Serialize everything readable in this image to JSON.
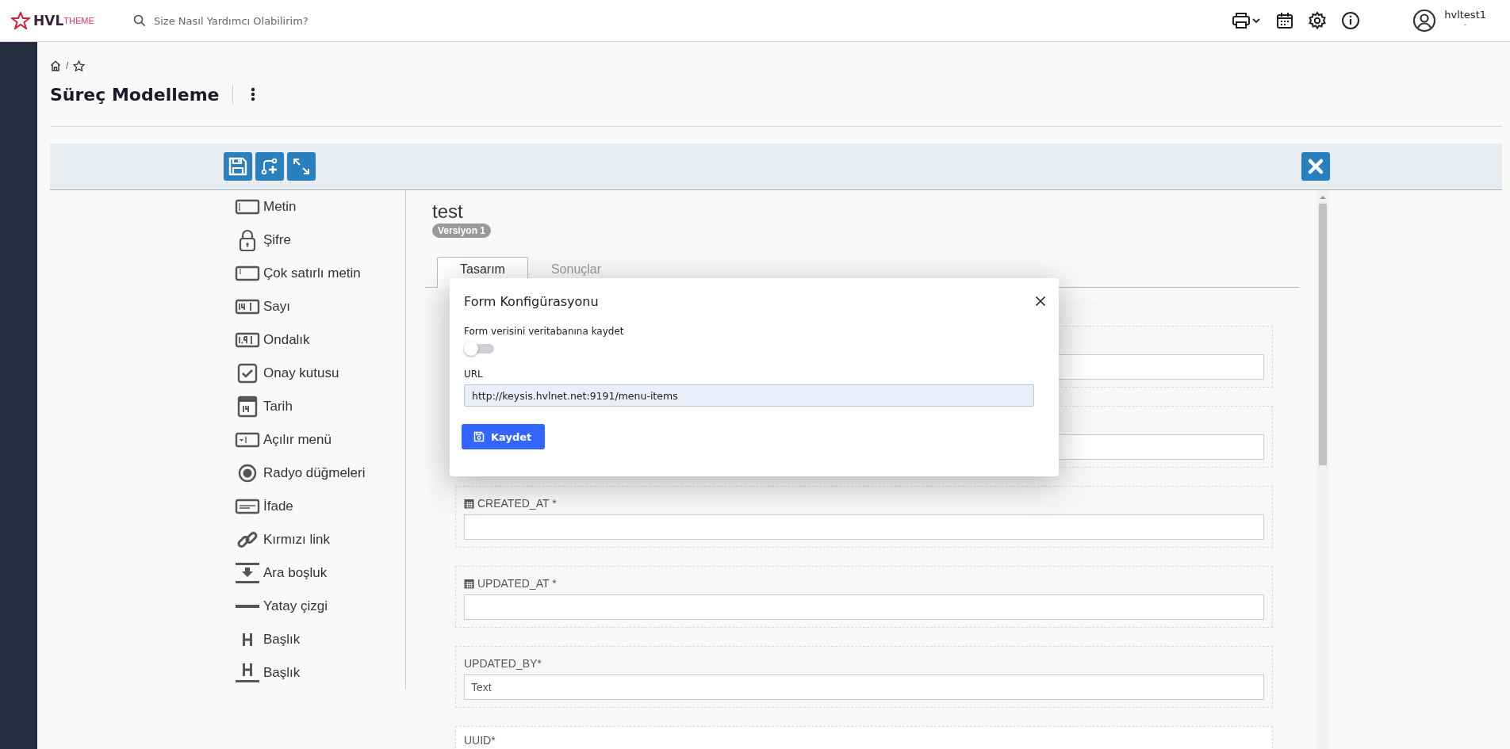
{
  "header": {
    "logo": {
      "brand": "HVL",
      "suffix": "THEME"
    },
    "search": {
      "placeholder": "Size Nasıl Yardımcı Olabilirim?"
    },
    "user": {
      "name": "hvltest1",
      "subtitle": "-"
    }
  },
  "page": {
    "title": "Süreç Modelleme",
    "breadcrumb_separator": "/"
  },
  "palette": [
    {
      "kind": "text",
      "label": "Metin"
    },
    {
      "kind": "password",
      "label": "Şifre"
    },
    {
      "kind": "textarea",
      "label": "Çok satırlı metin"
    },
    {
      "kind": "number",
      "label": "Sayı"
    },
    {
      "kind": "decimal",
      "label": "Ondalık"
    },
    {
      "kind": "checkbox",
      "label": "Onay kutusu"
    },
    {
      "kind": "date",
      "label": "Tarih"
    },
    {
      "kind": "select",
      "label": "Açılır menü"
    },
    {
      "kind": "radio",
      "label": "Radyo düğmeleri"
    },
    {
      "kind": "paragraph",
      "label": "İfade"
    },
    {
      "kind": "link",
      "label": "Kırmızı link"
    },
    {
      "kind": "spacer",
      "label": "Ara boşluk"
    },
    {
      "kind": "rule",
      "label": "Yatay çizgi"
    },
    {
      "kind": "heading",
      "label": "Başlık"
    },
    {
      "kind": "heading-underlined",
      "label": "Başlık"
    }
  ],
  "form": {
    "title": "test",
    "version": "Versiyon 1",
    "tabs": [
      {
        "label": "Tasarım",
        "selected": true
      },
      {
        "label": "Sonuçlar",
        "selected": false
      }
    ],
    "fields": [
      {
        "kind": "plain"
      },
      {
        "kind": "plain"
      },
      {
        "kind": "date",
        "label": "CREATED_AT *"
      },
      {
        "kind": "date",
        "label": "UPDATED_AT *"
      },
      {
        "kind": "plain",
        "label": "UPDATED_BY*",
        "value": "Text"
      },
      {
        "kind": "plain",
        "label": "UUID*"
      }
    ]
  },
  "modal": {
    "title": "Form Konfigürasyonu",
    "toggle": {
      "label": "Form verisini veritabanına kaydet",
      "on": false
    },
    "url": {
      "label": "URL",
      "value": "http://keysis.hvlnet.net:9191/menu-items"
    },
    "button": "Kaydet"
  }
}
